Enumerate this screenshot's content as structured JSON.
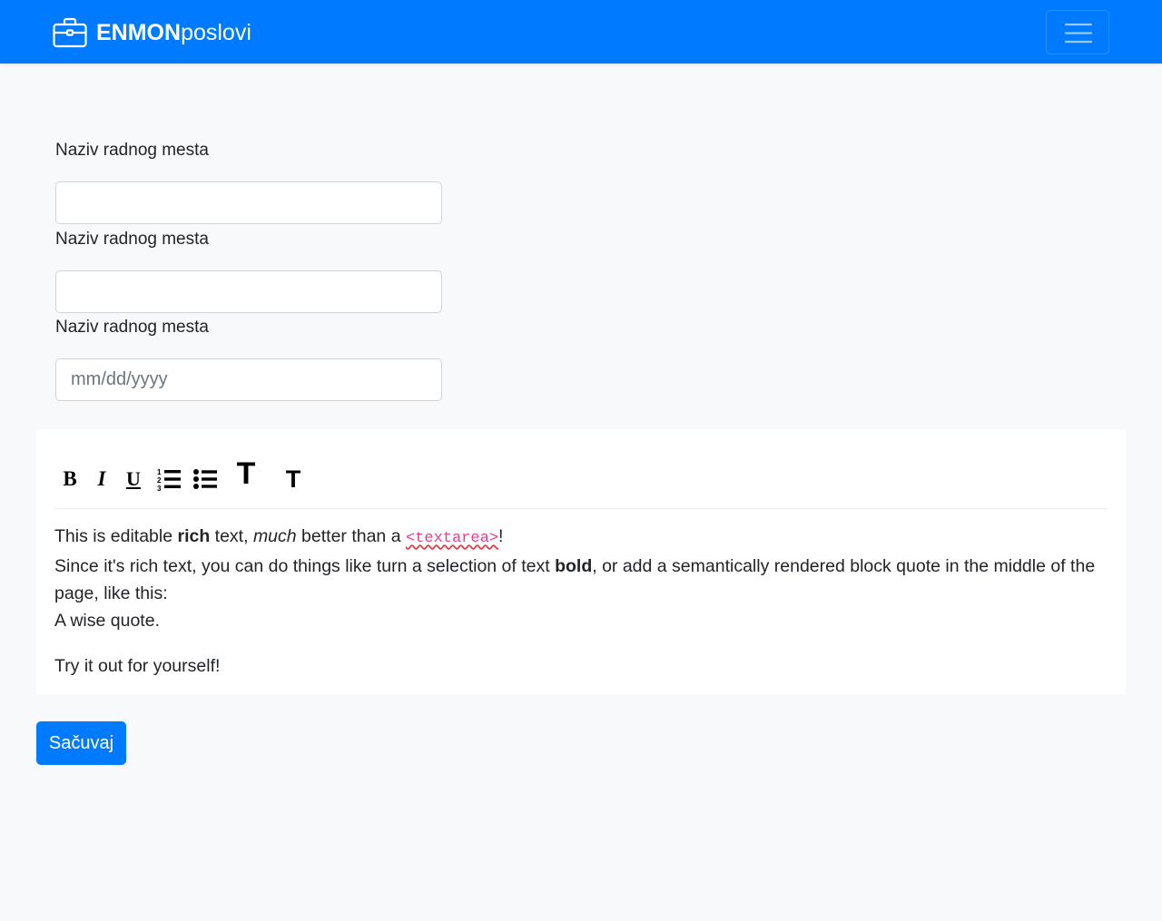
{
  "navbar": {
    "brand_bold": "ENMON",
    "brand_light": "poslovi",
    "brand_icon": "briefcase-icon",
    "menu_icon": "hamburger-menu-icon",
    "background_color": "#007bff"
  },
  "form": {
    "fields": [
      {
        "label": "Naziv radnog mesta",
        "value": "",
        "placeholder": ""
      },
      {
        "label": "Naziv radnog mesta",
        "value": "",
        "placeholder": ""
      },
      {
        "label": "Naziv radnog mesta",
        "value": "",
        "placeholder": "mm/dd/yyyy"
      }
    ]
  },
  "editor": {
    "toolbar": {
      "bold": "B",
      "italic": "I",
      "underline": "U",
      "ordered_list_icon": "ordered-list-icon",
      "bulleted_list_icon": "bulleted-list-icon",
      "heading1": "T",
      "heading2": "T"
    },
    "content": {
      "line1_a": "This is editable ",
      "line1_rich": "rich",
      "line1_b": " text, ",
      "line1_much": "much",
      "line1_c": " better than a ",
      "line1_code": "<textarea>",
      "line1_d": "!",
      "line2_a": "Since it's rich text, you can do things like turn a selection of text ",
      "line2_bold": "bold",
      "line2_b": ", or add a semantically rendered block quote in the middle of the page, like this:",
      "quote": "A wise quote.",
      "line4": "Try it out for yourself!"
    }
  },
  "actions": {
    "save_label": "Sačuvaj",
    "accent_color": "#007bff"
  }
}
